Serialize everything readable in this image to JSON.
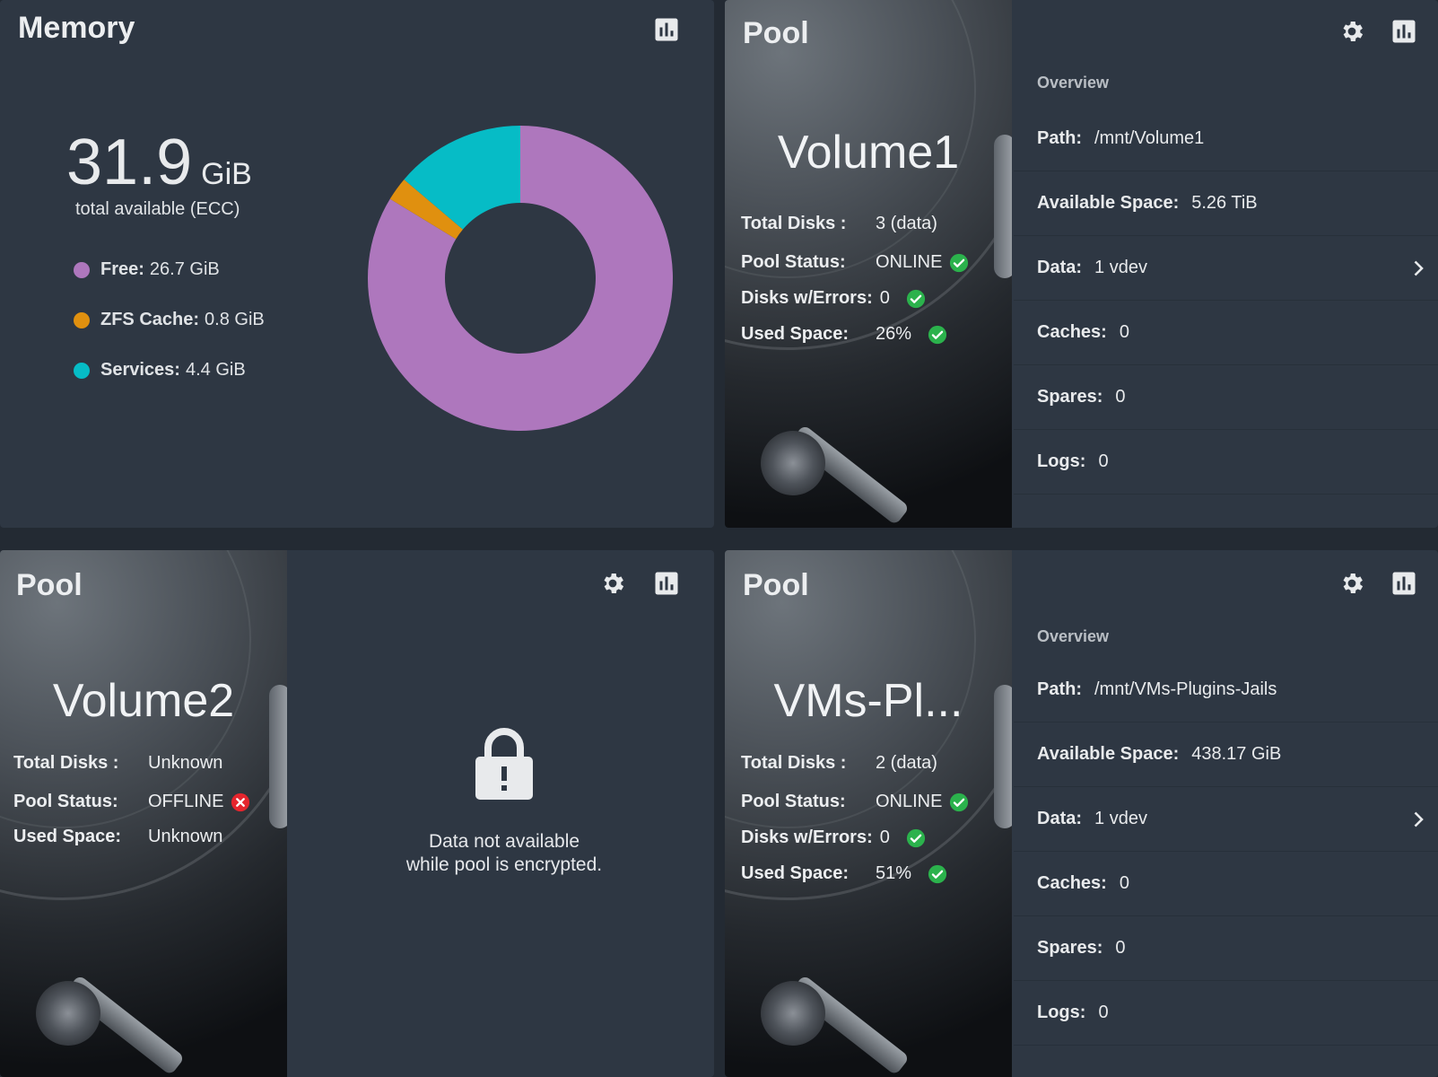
{
  "colors": {
    "free": "#ae77bd",
    "zfs_cache": "#e0900f",
    "services": "#06bcc6",
    "ok": "#2bb24c",
    "error": "#e5252d"
  },
  "memory": {
    "title": "Memory",
    "total_value": "31.9",
    "total_unit": "GiB",
    "total_label": "total available (ECC)",
    "legend": [
      {
        "label": "Free:",
        "value": "26.7 GiB"
      },
      {
        "label": "ZFS Cache:",
        "value": "0.8 GiB"
      },
      {
        "label": "Services:",
        "value": "4.4 GiB"
      }
    ],
    "chart_data": {
      "type": "pie",
      "categories": [
        "Free",
        "ZFS Cache",
        "Services"
      ],
      "values": [
        26.7,
        0.8,
        4.4
      ],
      "unit": "GiB"
    }
  },
  "pools": [
    {
      "title": "Pool",
      "name": "Volume1",
      "stats": [
        {
          "label": "Total Disks :",
          "value": "3 (data)",
          "status": ""
        },
        {
          "label": "Pool Status:",
          "value": "ONLINE",
          "status": "ok"
        },
        {
          "label": "Disks w/Errors:",
          "value": "0",
          "status": "ok"
        },
        {
          "label": "Used Space:",
          "value": "26%",
          "status": "ok"
        }
      ],
      "overview_label": "Overview",
      "details": [
        {
          "key": "Path:",
          "value": "/mnt/Volume1"
        },
        {
          "key": "Available Space:",
          "value": "5.26 TiB"
        },
        {
          "key": "Data:",
          "value": "1 vdev"
        },
        {
          "key": "Caches:",
          "value": "0"
        },
        {
          "key": "Spares:",
          "value": "0"
        },
        {
          "key": "Logs:",
          "value": "0"
        }
      ]
    },
    {
      "title": "Pool",
      "name": "Volume2",
      "stats": [
        {
          "label": "Total Disks :",
          "value": "Unknown",
          "status": ""
        },
        {
          "label": "Pool Status:",
          "value": "OFFLINE",
          "status": "error"
        },
        {
          "label": "Used Space:",
          "value": "Unknown",
          "status": ""
        }
      ],
      "encrypted_message_line1": "Data not available",
      "encrypted_message_line2": "while pool is encrypted."
    },
    {
      "title": "Pool",
      "name": "VMs-Pl...",
      "stats": [
        {
          "label": "Total Disks :",
          "value": "2 (data)",
          "status": ""
        },
        {
          "label": "Pool Status:",
          "value": "ONLINE",
          "status": "ok"
        },
        {
          "label": "Disks w/Errors:",
          "value": "0",
          "status": "ok"
        },
        {
          "label": "Used Space:",
          "value": "51%",
          "status": "ok"
        }
      ],
      "overview_label": "Overview",
      "details": [
        {
          "key": "Path:",
          "value": "/mnt/VMs-Plugins-Jails"
        },
        {
          "key": "Available Space:",
          "value": "438.17 GiB"
        },
        {
          "key": "Data:",
          "value": "1 vdev"
        },
        {
          "key": "Caches:",
          "value": "0"
        },
        {
          "key": "Spares:",
          "value": "0"
        },
        {
          "key": "Logs:",
          "value": "0"
        }
      ]
    }
  ]
}
